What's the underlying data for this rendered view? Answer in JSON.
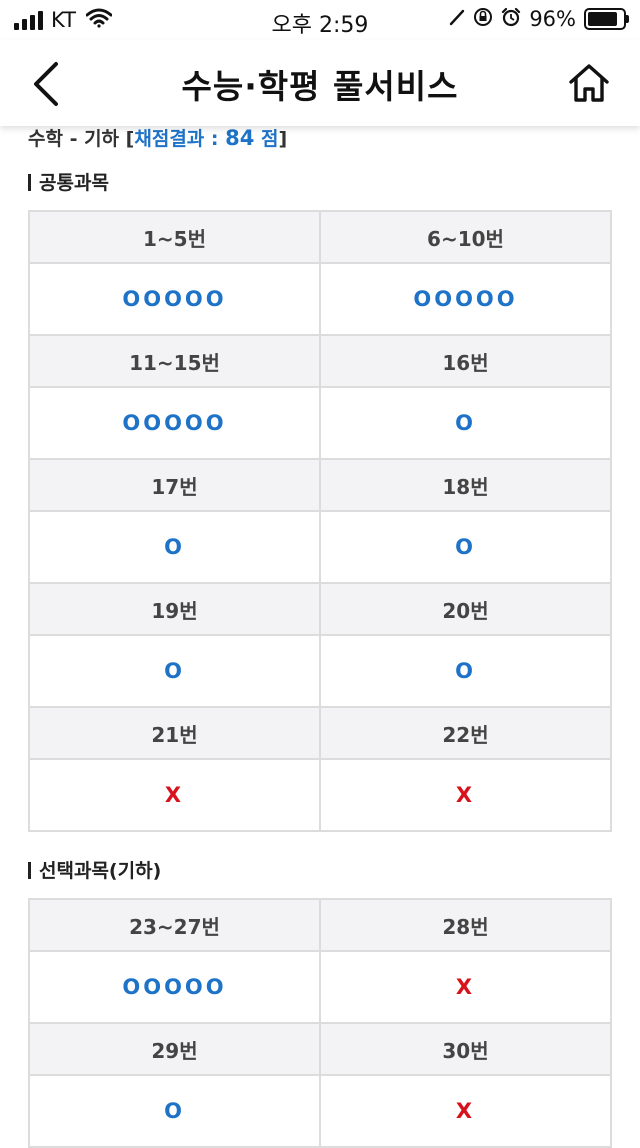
{
  "status_bar": {
    "carrier": "KT",
    "time": "오후 2:59",
    "battery_percent": "96%",
    "battery_level": 0.96
  },
  "header": {
    "title": "수능·학평 풀서비스",
    "back_icon": "chevron-left-icon",
    "home_icon": "home-icon"
  },
  "score": {
    "subject": "수학 - 기하",
    "label": "채점결과 :",
    "value": "84",
    "unit": "점"
  },
  "sections": [
    {
      "title": "공통과목",
      "rows": [
        {
          "headers": [
            "1~5번",
            "6~10번"
          ],
          "marks": [
            "OOOOO",
            "OOOOO"
          ]
        },
        {
          "headers": [
            "11~15번",
            "16번"
          ],
          "marks": [
            "OOOOO",
            "O"
          ]
        },
        {
          "headers": [
            "17번",
            "18번"
          ],
          "marks": [
            "O",
            "O"
          ]
        },
        {
          "headers": [
            "19번",
            "20번"
          ],
          "marks": [
            "O",
            "O"
          ]
        },
        {
          "headers": [
            "21번",
            "22번"
          ],
          "marks": [
            "X",
            "X"
          ]
        }
      ]
    },
    {
      "title": "선택과목(기하)",
      "rows": [
        {
          "headers": [
            "23~27번",
            "28번"
          ],
          "marks": [
            "OOOOO",
            "X"
          ]
        },
        {
          "headers": [
            "29번",
            "30번"
          ],
          "marks": [
            "O",
            "X"
          ]
        }
      ]
    }
  ],
  "colors": {
    "correct": "#1e73c8",
    "wrong": "#d8121c",
    "header_bg": "#f3f3f5",
    "border": "#dcdcdc"
  }
}
